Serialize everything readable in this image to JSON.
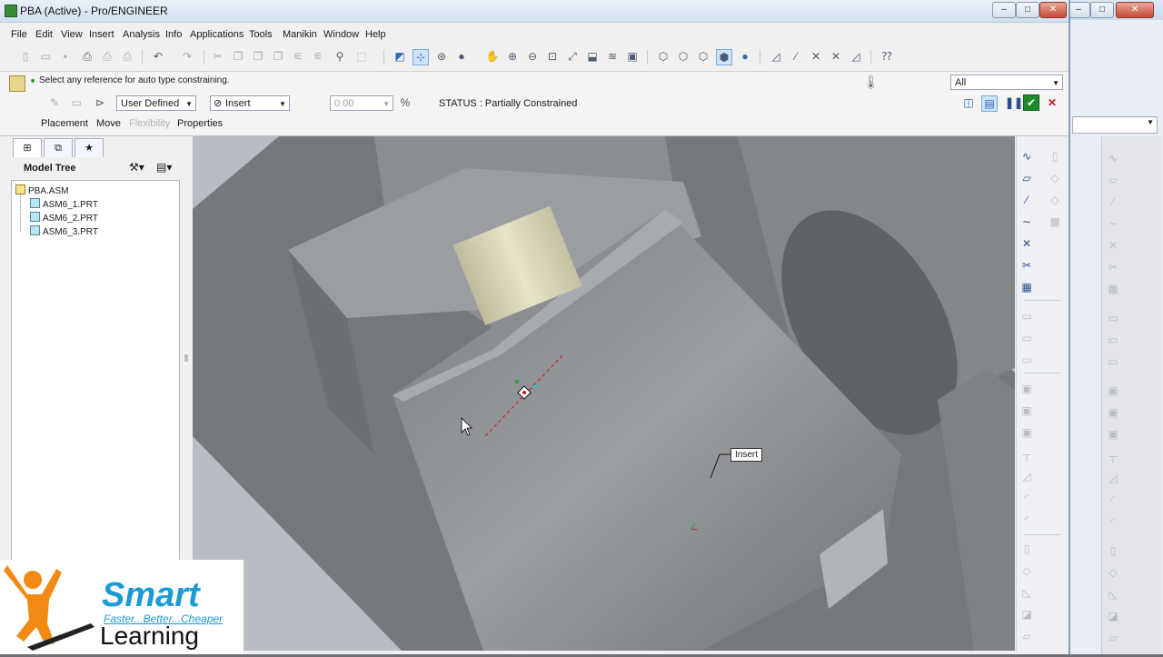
{
  "window": {
    "title": "PBA (Active) - Pro/ENGINEER",
    "min_icon": "minimize-icon",
    "max_icon": "maximize-icon",
    "close_icon": "close-icon"
  },
  "menu": [
    "File",
    "Edit",
    "View",
    "Insert",
    "Analysis",
    "Info",
    "Applications",
    "Tools",
    "Manikin",
    "Window",
    "Help"
  ],
  "prompt": {
    "text": "Select any reference for auto type constraining."
  },
  "filter": {
    "value": "All"
  },
  "dashboard": {
    "constraint_set": "User Defined",
    "constraint_type": "Insert",
    "offset_value": "0.00",
    "status": "STATUS : Partially Constrained",
    "tabs": [
      "Placement",
      "Move",
      "Flexibility",
      "Properties"
    ]
  },
  "model_tree": {
    "title": "Model Tree",
    "root": "PBA.ASM",
    "children": [
      "ASM6_1.PRT",
      "ASM6_2.PRT",
      "ASM6_3.PRT"
    ]
  },
  "viewport": {
    "tooltip": "Insert"
  },
  "logo": {
    "brand": "Smart",
    "tagline": "Faster...Better...Cheaper",
    "word": "Learning"
  },
  "colors": {
    "brand_blue": "#1b9ad6",
    "confirm_green": "#1f8a2c",
    "cancel_red": "#c21d1d",
    "model_gray": "#8e9196",
    "pin_cream": "#d9d6b8"
  }
}
